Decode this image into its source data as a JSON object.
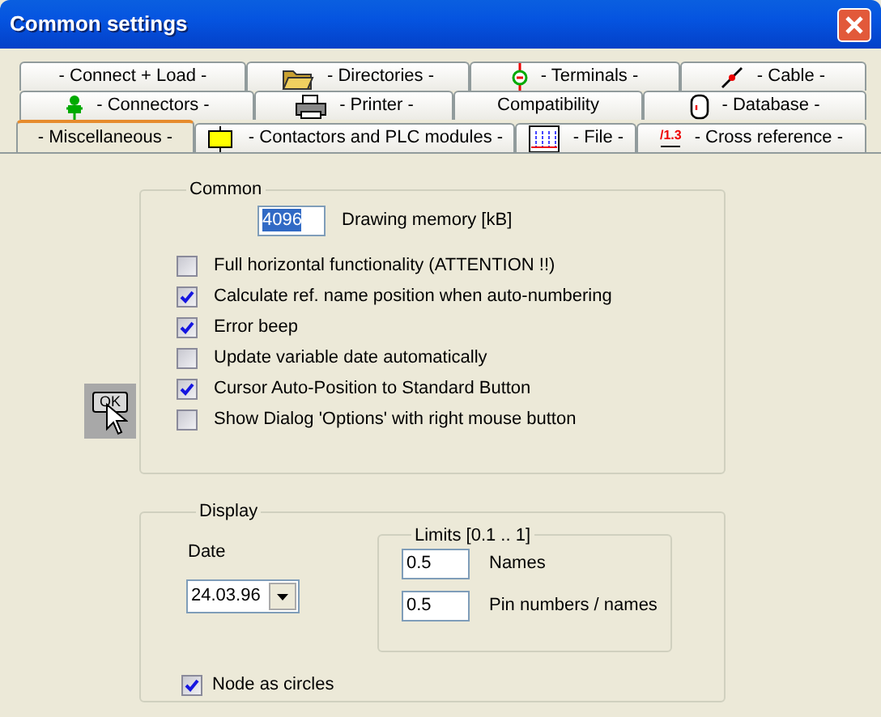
{
  "window": {
    "title": "Common settings"
  },
  "tab_rows": [
    [
      {
        "label": "- Connect + Load -",
        "selected": false
      },
      {
        "label": "- Directories -",
        "kind": "folder",
        "selected": false
      },
      {
        "label": "- Terminals -",
        "kind": "terminal",
        "selected": false
      },
      {
        "label": "- Cable -",
        "kind": "cable",
        "selected": false
      }
    ],
    [
      {
        "label": "- Connectors -",
        "kind": "connector",
        "selected": false
      },
      {
        "label": "- Printer -",
        "kind": "printer",
        "selected": false
      },
      {
        "label": "Compatibility",
        "selected": false
      },
      {
        "label": "- Database -",
        "kind": "database",
        "selected": false
      }
    ],
    [
      {
        "label": "- Miscellaneous -",
        "selected": true
      },
      {
        "label": "- Contactors and PLC modules -",
        "kind": "contactor",
        "selected": false
      },
      {
        "label": "- File -",
        "kind": "grid",
        "selected": false
      },
      {
        "label": "- Cross reference -",
        "kind": "crossref",
        "icon_text": "/1.3",
        "selected": false
      }
    ]
  ],
  "common": {
    "title": "Common",
    "memory": {
      "value": "4096",
      "label": "Drawing memory [kB]"
    },
    "options": [
      {
        "label": "Full horizontal functionality (ATTENTION !!)",
        "checked": false
      },
      {
        "label": "Calculate ref. name position when auto-numbering",
        "checked": true
      },
      {
        "label": "Error beep",
        "checked": true
      },
      {
        "label": "Update variable date automatically",
        "checked": false
      },
      {
        "label": "Cursor Auto-Position to Standard Button",
        "checked": true
      },
      {
        "label": "Show Dialog 'Options' with right mouse button",
        "checked": false
      }
    ]
  },
  "cursor_button": {
    "label": "OK"
  },
  "display": {
    "title": "Display",
    "date_label": "Date",
    "date_value": "24.03.96",
    "limits": {
      "title": "Limits [0.1 .. 1]",
      "fields": [
        {
          "value": "0.5",
          "label": "Names"
        },
        {
          "value": "0.5",
          "label": "Pin numbers / names"
        }
      ]
    },
    "node_as_circles": {
      "label": "Node as circles",
      "checked": true
    }
  }
}
